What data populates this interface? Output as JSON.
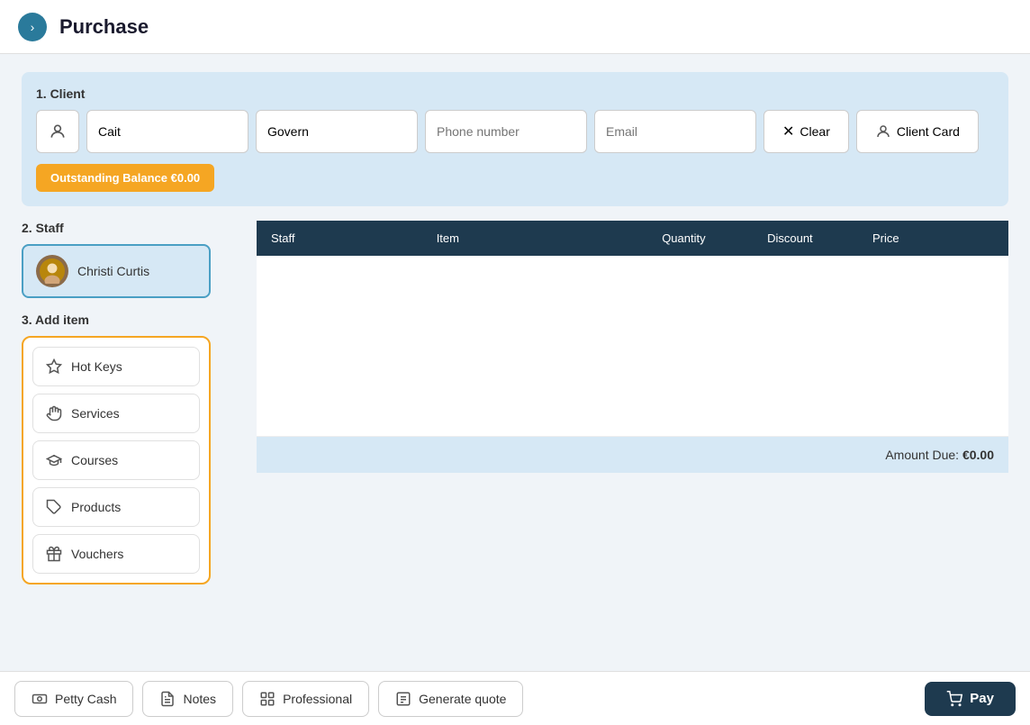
{
  "header": {
    "toggle_icon": "›",
    "title": "Purchase"
  },
  "client_section": {
    "label": "1. Client",
    "first_name": "Cait",
    "last_name": "Govern",
    "phone_placeholder": "Phone number",
    "email_placeholder": "Email",
    "clear_label": "Clear",
    "client_card_label": "Client Card",
    "outstanding_balance": "Outstanding Balance €0.00"
  },
  "staff_section": {
    "label": "2. Staff",
    "staff_name": "Christi Curtis"
  },
  "table": {
    "columns": [
      "Staff",
      "Item",
      "Quantity",
      "Discount",
      "Price",
      ""
    ],
    "amount_due_label": "Amount Due:",
    "amount_due_value": "€0.00"
  },
  "add_item_section": {
    "label": "3. Add item",
    "buttons": [
      {
        "id": "hot-keys",
        "label": "Hot Keys",
        "icon": "star"
      },
      {
        "id": "services",
        "label": "Services",
        "icon": "hand"
      },
      {
        "id": "courses",
        "label": "Courses",
        "icon": "graduation"
      },
      {
        "id": "products",
        "label": "Products",
        "icon": "tag"
      },
      {
        "id": "vouchers",
        "label": "Vouchers",
        "icon": "gift"
      }
    ]
  },
  "bottom_bar": {
    "buttons": [
      {
        "id": "petty-cash",
        "label": "Petty Cash",
        "icon": "cash"
      },
      {
        "id": "notes",
        "label": "Notes",
        "icon": "note"
      },
      {
        "id": "professional",
        "label": "Professional",
        "icon": "professional"
      },
      {
        "id": "generate-quote",
        "label": "Generate quote",
        "icon": "quote"
      }
    ],
    "pay_label": "Pay",
    "pay_icon": "cart"
  }
}
